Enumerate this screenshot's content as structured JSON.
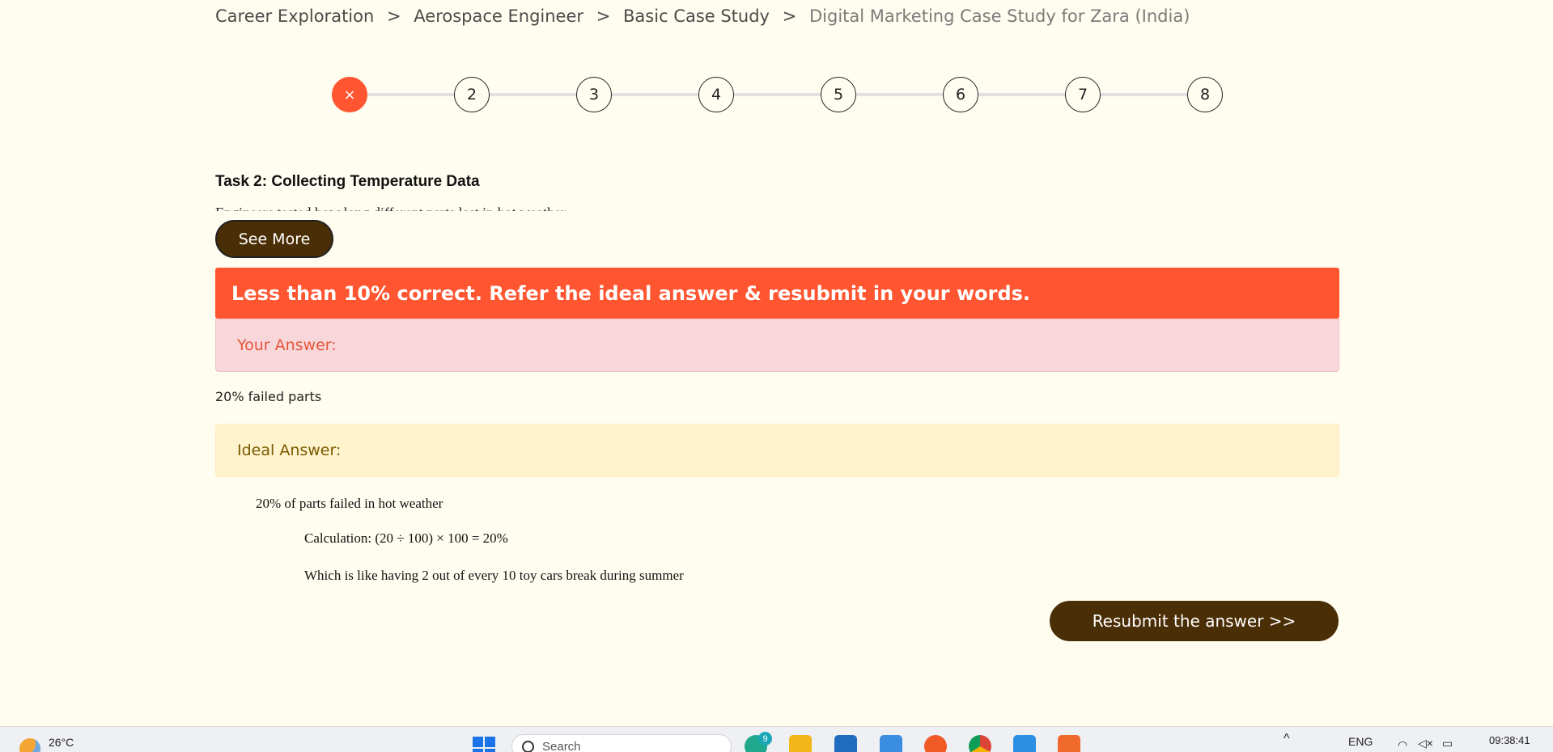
{
  "breadcrumb": {
    "items": [
      "Career Exploration",
      "Aerospace Engineer",
      "Basic Case Study"
    ],
    "separator": ">",
    "current": "Digital Marketing Case Study for Zara (India)"
  },
  "stepper": {
    "active_symbol": "×",
    "steps": [
      "2",
      "3",
      "4",
      "5",
      "6",
      "7",
      "8"
    ]
  },
  "task": {
    "title": "Task 2: Collecting Temperature Data",
    "description": "Engineers tested how long different parts last in hot weather",
    "see_more_label": "See More"
  },
  "result": {
    "banner_text": "Less than 10% correct. Refer the ideal answer & resubmit in your words.",
    "your_answer_label": "Your Answer:",
    "your_answer_text": "20% failed parts",
    "ideal_answer_label": "Ideal Answer:",
    "ideal_lines": [
      "20% of parts failed in hot weather",
      "Calculation: (20 ÷ 100) × 100 = 20%",
      "Which is like having 2 out of every 10 toy cars break during summer"
    ],
    "resubmit_label": "Resubmit the answer >>"
  },
  "taskbar": {
    "temperature": "26°C",
    "search_placeholder": "Search",
    "whatsapp_badge": "9",
    "language": "ENG",
    "clock": "09:38:41"
  },
  "colors": {
    "accent_orange": "#ff5530",
    "brown": "#4a2e06",
    "page_bg": "#fffdf0"
  }
}
